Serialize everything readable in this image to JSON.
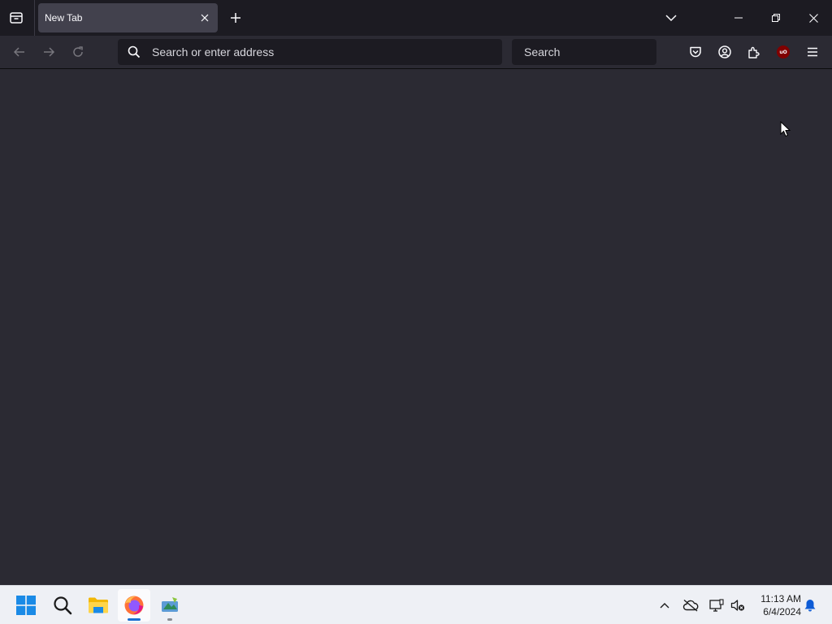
{
  "browser": {
    "tab": {
      "title": "New Tab"
    },
    "urlbar": {
      "placeholder": "Search or enter address",
      "value": ""
    },
    "searchbar": {
      "placeholder": "Search",
      "value": ""
    },
    "extensions": {
      "ublock_label": "uO"
    },
    "colors": {
      "toolbar": "#2b2a33",
      "tabstrip": "#1c1b22",
      "selected_tab": "#42414d",
      "text": "#fbfbfe"
    }
  },
  "icons": [
    "tab-list-icon",
    "close-icon",
    "plus-icon",
    "chevron-down-icon",
    "minimize-icon",
    "restore-icon",
    "window-close-icon",
    "back-arrow-icon",
    "forward-arrow-icon",
    "reload-icon",
    "search-icon",
    "pocket-icon",
    "account-icon",
    "extensions-icon",
    "ublock-icon",
    "hamburger-menu-icon"
  ],
  "taskbar": {
    "apps": [
      "windows-start-icon",
      "search-icon",
      "file-explorer-icon",
      "firefox-icon",
      "app-icon"
    ],
    "clock": {
      "time": "11:13 AM",
      "date": "6/4/2024"
    },
    "colors": {
      "background": "#eef0f5",
      "active_indicator": "#1a6fd1"
    }
  }
}
